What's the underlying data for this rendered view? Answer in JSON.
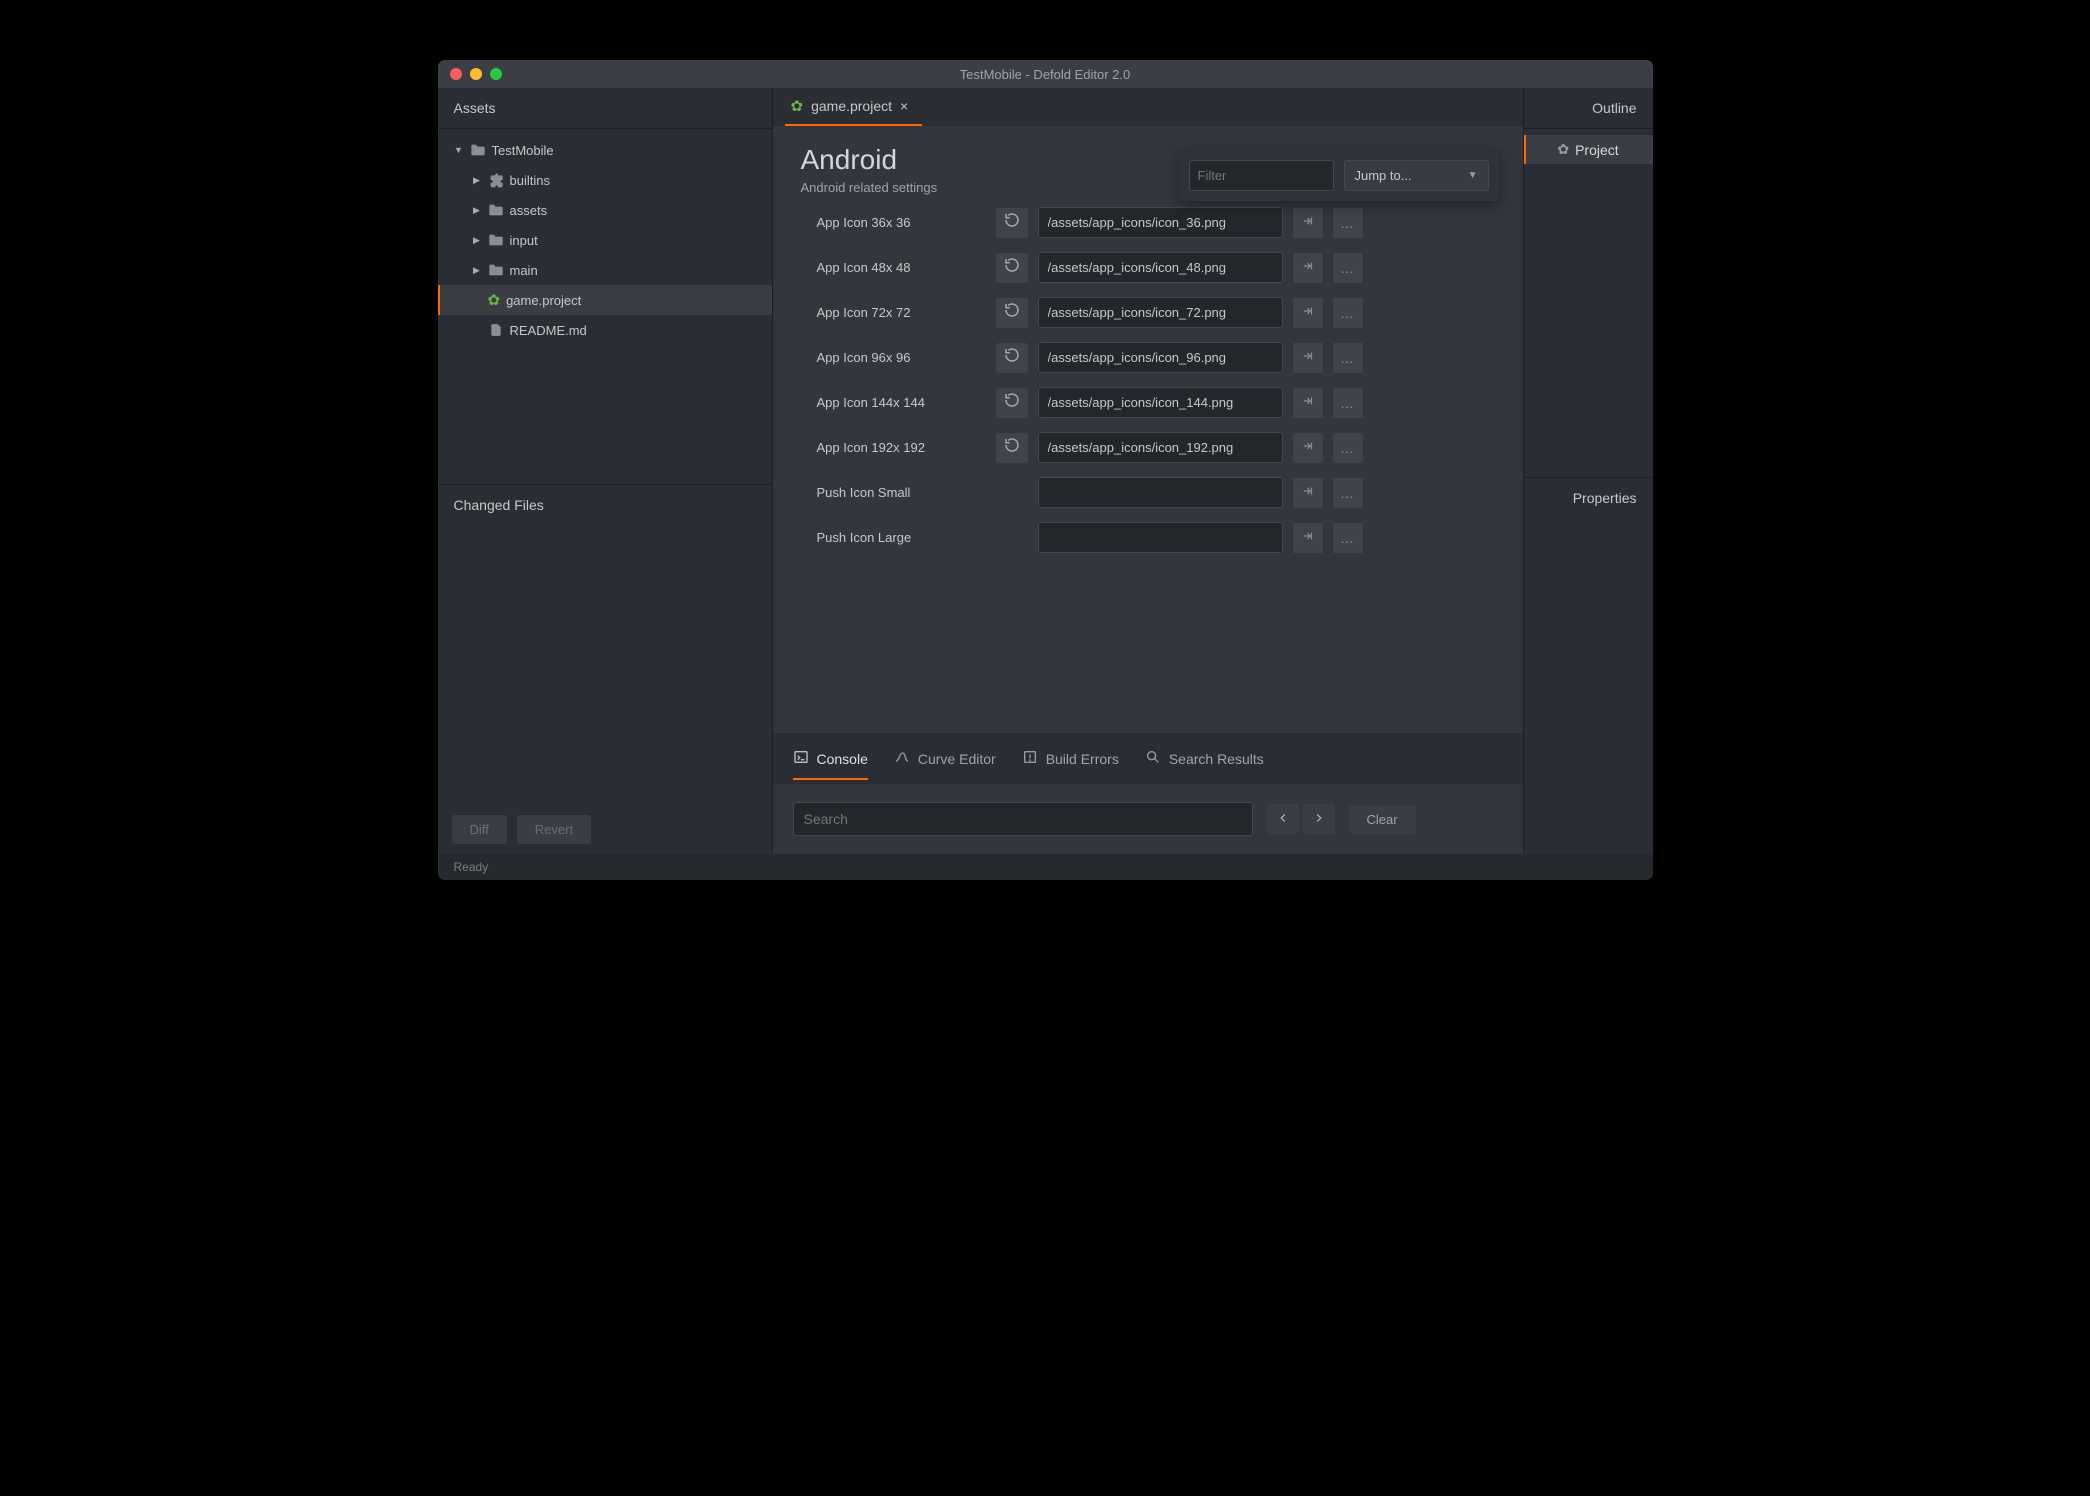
{
  "window": {
    "title": "TestMobile - Defold Editor 2.0"
  },
  "assets": {
    "header": "Assets",
    "root": "TestMobile",
    "folders": [
      "builtins",
      "assets",
      "input",
      "main"
    ],
    "files": [
      {
        "name": "game.project",
        "selected": true
      },
      {
        "name": "README.md",
        "selected": false
      }
    ]
  },
  "changed_files": {
    "header": "Changed Files",
    "diff": "Diff",
    "revert": "Revert"
  },
  "editor": {
    "tab_label": "game.project",
    "section_title": "Android",
    "section_subtitle": "Android related settings",
    "filter_placeholder": "Filter",
    "jump_label": "Jump to...",
    "props": [
      {
        "label": "App Icon 36x 36",
        "value": "/assets/app_icons/icon_36.png",
        "reset": true
      },
      {
        "label": "App Icon 48x 48",
        "value": "/assets/app_icons/icon_48.png",
        "reset": true
      },
      {
        "label": "App Icon 72x 72",
        "value": "/assets/app_icons/icon_72.png",
        "reset": true
      },
      {
        "label": "App Icon 96x 96",
        "value": "/assets/app_icons/icon_96.png",
        "reset": true
      },
      {
        "label": "App Icon 144x 144",
        "value": "/assets/app_icons/icon_144.png",
        "reset": true
      },
      {
        "label": "App Icon 192x 192",
        "value": "/assets/app_icons/icon_192.png",
        "reset": true
      },
      {
        "label": "Push Icon Small",
        "value": "",
        "reset": false
      },
      {
        "label": "Push Icon Large",
        "value": "",
        "reset": false
      }
    ]
  },
  "bottom_tabs": {
    "console": "Console",
    "curve": "Curve Editor",
    "build": "Build Errors",
    "search": "Search Results"
  },
  "console": {
    "search_placeholder": "Search",
    "clear": "Clear"
  },
  "outline": {
    "header": "Outline",
    "item": "Project"
  },
  "properties": {
    "header": "Properties"
  },
  "status": "Ready"
}
